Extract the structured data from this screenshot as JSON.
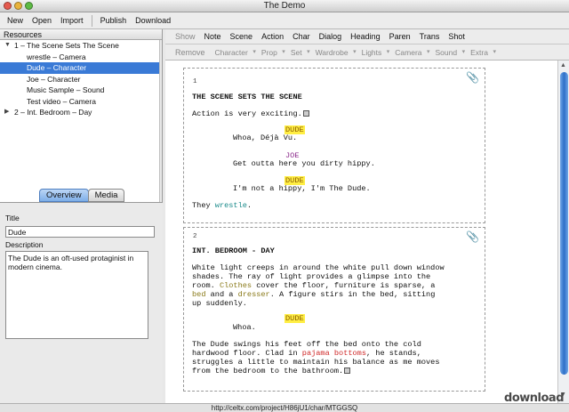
{
  "window": {
    "title": "The Demo"
  },
  "toolbar": {
    "new": "New",
    "open": "Open",
    "import": "Import",
    "publish": "Publish",
    "download": "Download"
  },
  "resources": {
    "header": "Resources",
    "items": [
      {
        "num": "1",
        "label": "The Scene Sets The Scene",
        "expanded": true
      },
      {
        "label": "wrestle – Camera"
      },
      {
        "label": "Dude – Character",
        "selected": true
      },
      {
        "label": "Joe – Character"
      },
      {
        "label": "Music Sample – Sound"
      },
      {
        "label": "Test video – Camera"
      },
      {
        "num": "2",
        "label": "Int. Bedroom – Day",
        "expanded": false
      }
    ]
  },
  "tabs": {
    "overview": "Overview",
    "media": "Media"
  },
  "overview": {
    "title_label": "Title",
    "title_value": "Dude",
    "description_label": "Description",
    "description_value": "The Dude is an oft-used protaginist in modern cinema."
  },
  "format_bar": {
    "show": "Show",
    "note": "Note",
    "scene": "Scene",
    "action": "Action",
    "char": "Char",
    "dialog": "Dialog",
    "heading": "Heading",
    "paren": "Paren",
    "trans": "Trans",
    "shot": "Shot"
  },
  "breakdown_bar": {
    "remove": "Remove",
    "character": "Character",
    "prop": "Prop",
    "set": "Set",
    "wardrobe": "Wardrobe",
    "lights": "Lights",
    "camera": "Camera",
    "sound": "Sound",
    "extra": "Extra"
  },
  "script": {
    "page1": {
      "num": "1",
      "scene": "THE SCENE SETS THE SCENE",
      "action": "Action is very exciting.",
      "char1": "DUDE",
      "dialog1": "Whoa, Déjà Vu.",
      "char2": "JOE",
      "dialog2": "Get outta here you dirty hippy.",
      "char3": "DUDE",
      "dialog3": "I'm not a hippy, I'm The Dude.",
      "closing_pre": "They ",
      "closing_kw": "wrestle",
      "closing_post": "."
    },
    "page2": {
      "num": "2",
      "scene": "INT. BEDROOM - DAY",
      "a1": "White light creeps in around the white pull down window",
      "a2": "shades. The ray of light provides a glimpse into the",
      "a3_pre": "room.  ",
      "a3_kw": "Clothes",
      "a3_post": " cover the floor, furniture is sparse, a",
      "a4_kw1": "bed",
      "a4_mid": " and a ",
      "a4_kw2": "dresser",
      "a4_post": ". A figure stirs in the bed, sitting",
      "a5": "up suddenly.",
      "char": "DUDE",
      "dialog": "Whoa.",
      "b1": "The Dude swings his feet off the bed onto the cold",
      "b2_pre": "hardwood floor.  Clad in ",
      "b2_kw": "pajama bottoms",
      "b2_post": ", he stands,",
      "b3": "struggles a little to maintain his balance as me moves",
      "b4": "from the bedroom to the bathroom."
    }
  },
  "status": {
    "url": "http://celtx.com/project/H86jU1/char/MTGGSQ"
  },
  "watermark": {
    "text": "download"
  },
  "colors": {
    "selection": "#3a7ad6",
    "character_highlight": "#ffee44",
    "tab_active": "#7eaee8"
  }
}
